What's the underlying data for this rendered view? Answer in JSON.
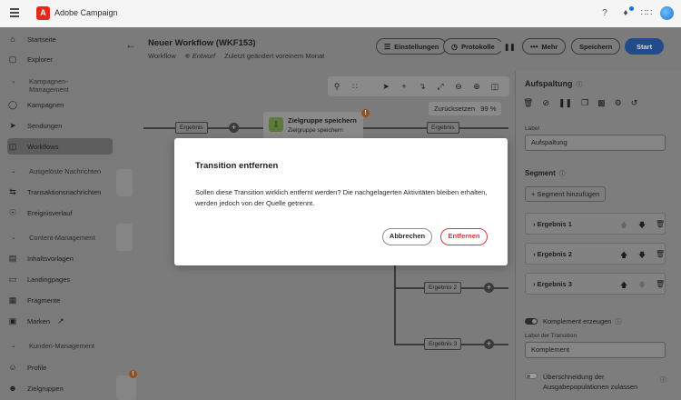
{
  "app": {
    "logo_glyph": "A",
    "name": "Adobe Campaign"
  },
  "topbar": {
    "icons": [
      "help-icon",
      "bell-icon",
      "apps-grid-icon",
      "avatar"
    ]
  },
  "sidebar": {
    "items": [
      {
        "label": "Startseite",
        "icon": "home-icon"
      },
      {
        "label": "Explorer",
        "icon": "explorer-icon"
      },
      {
        "label": "Kampagnen",
        "icon": "campaign-icon"
      },
      {
        "label": "Sendungen",
        "icon": "send-icon"
      },
      {
        "label": "Workflows",
        "icon": "workflow-icon",
        "active": true
      },
      {
        "label": "Transaktionsnachrichten",
        "icon": "transaction-icon"
      },
      {
        "label": "Ereignisverlauf",
        "icon": "history-icon"
      },
      {
        "label": "Inhaltsvorlagen",
        "icon": "template-icon"
      },
      {
        "label": "Landingpages",
        "icon": "landing-icon"
      },
      {
        "label": "Fragmente",
        "icon": "fragment-icon"
      },
      {
        "label": "Marken",
        "icon": "brand-icon"
      },
      {
        "label": "Profile",
        "icon": "profile-icon"
      },
      {
        "label": "Zielgruppen",
        "icon": "audience-icon"
      }
    ],
    "sections": {
      "campaign_mgmt_line1": "Kampagnen-",
      "campaign_mgmt_line2": "Management",
      "triggered": "Ausgelöste Nachrichten",
      "content_mgmt": "Content-Management",
      "customer_mgmt": "Kunden-Management"
    }
  },
  "header": {
    "title": "Neuer Workflow (WKF153)",
    "breadcrumb": "Workflow",
    "status": "Entwurf",
    "modified": "Zuletzt geändert voreinem Monat",
    "settings_label": "Einstellungen",
    "protocol_label": "Protokolle",
    "more_label": "Mehr",
    "save_label": "Speichern",
    "start_label": "Start"
  },
  "canvas": {
    "reset_label": "Zurücksetzen",
    "zoom": "99 %",
    "node_title": "Zielgruppe speichern",
    "node_subtitle": "Zielgruppe speichern",
    "edge_labels": [
      "Ergebnis",
      "Ergebnis",
      "Ergebnis 2",
      "Ergebnis 3"
    ]
  },
  "panel": {
    "title": "Aufspaltung",
    "label_caption": "Label",
    "label_value": "Aufspaltung",
    "segment_heading": "Segment",
    "add_segment": "Segment hinzufügen",
    "segments": [
      "Ergebnis 1",
      "Ergebnis 2",
      "Ergebnis 3"
    ],
    "complement_label": "Komplement erzeugen",
    "complement_on": true,
    "transition_caption": "Label der Transition",
    "transition_value": "Komplement",
    "overlap_line1": "Überschneidung der",
    "overlap_line2": "Ausgabepopulationen zulassen",
    "overlap_on": false
  },
  "modal": {
    "title": "Transition entfernen",
    "body": "Sollen diese Transition wirklich entfernt werden? Die nachgelagerten Aktivitäten bleiben erhalten, werden jedoch von der Quelle getrennt.",
    "cancel_label": "Abbrechen",
    "confirm_label": "Entfernen",
    "confirm_color": "#d7373f"
  }
}
